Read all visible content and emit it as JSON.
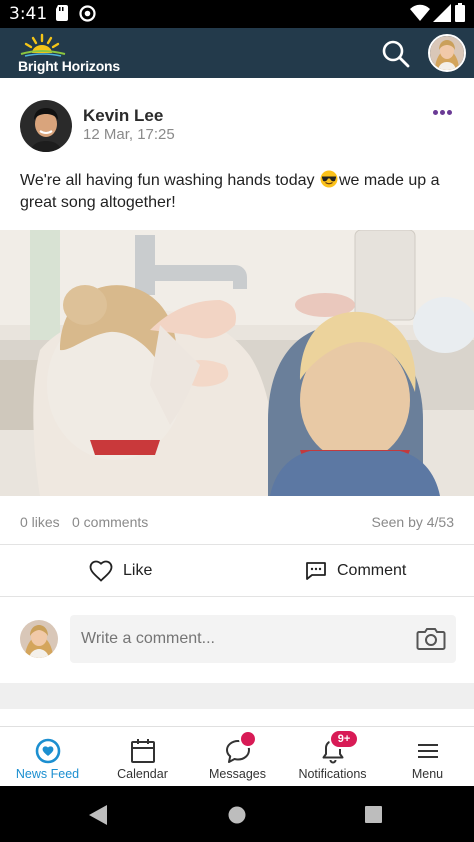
{
  "status_bar": {
    "time": "3:41"
  },
  "app_bar": {
    "logo_text": "Bright Horizons"
  },
  "post": {
    "author": "Kevin Lee",
    "timestamp": "12 Mar, 17:25",
    "text_before_emoji": "We're all having fun washing hands today ",
    "emoji": "smiling-face-with-sunglasses",
    "text_after_emoji": "we made up a great song altogether!",
    "likes": "0 likes",
    "comments": "0 comments",
    "seen_by": "Seen by 4/53",
    "like_label": "Like",
    "comment_label": "Comment"
  },
  "comment_box": {
    "placeholder": "Write a comment..."
  },
  "bottom_nav": {
    "items": [
      {
        "label": "News Feed",
        "icon": "heart-bubble-icon",
        "active": true
      },
      {
        "label": "Calendar",
        "icon": "calendar-icon"
      },
      {
        "label": "Messages",
        "icon": "chat-bubble-icon",
        "badge": ""
      },
      {
        "label": "Notifications",
        "icon": "bell-icon",
        "badge": "9+"
      },
      {
        "label": "Menu",
        "icon": "hamburger-menu-icon"
      }
    ]
  },
  "colors": {
    "app_bar": "#233a4b",
    "accent": "#1c8fd0",
    "badge": "#d81b56",
    "more_dots": "#6a3a95"
  }
}
